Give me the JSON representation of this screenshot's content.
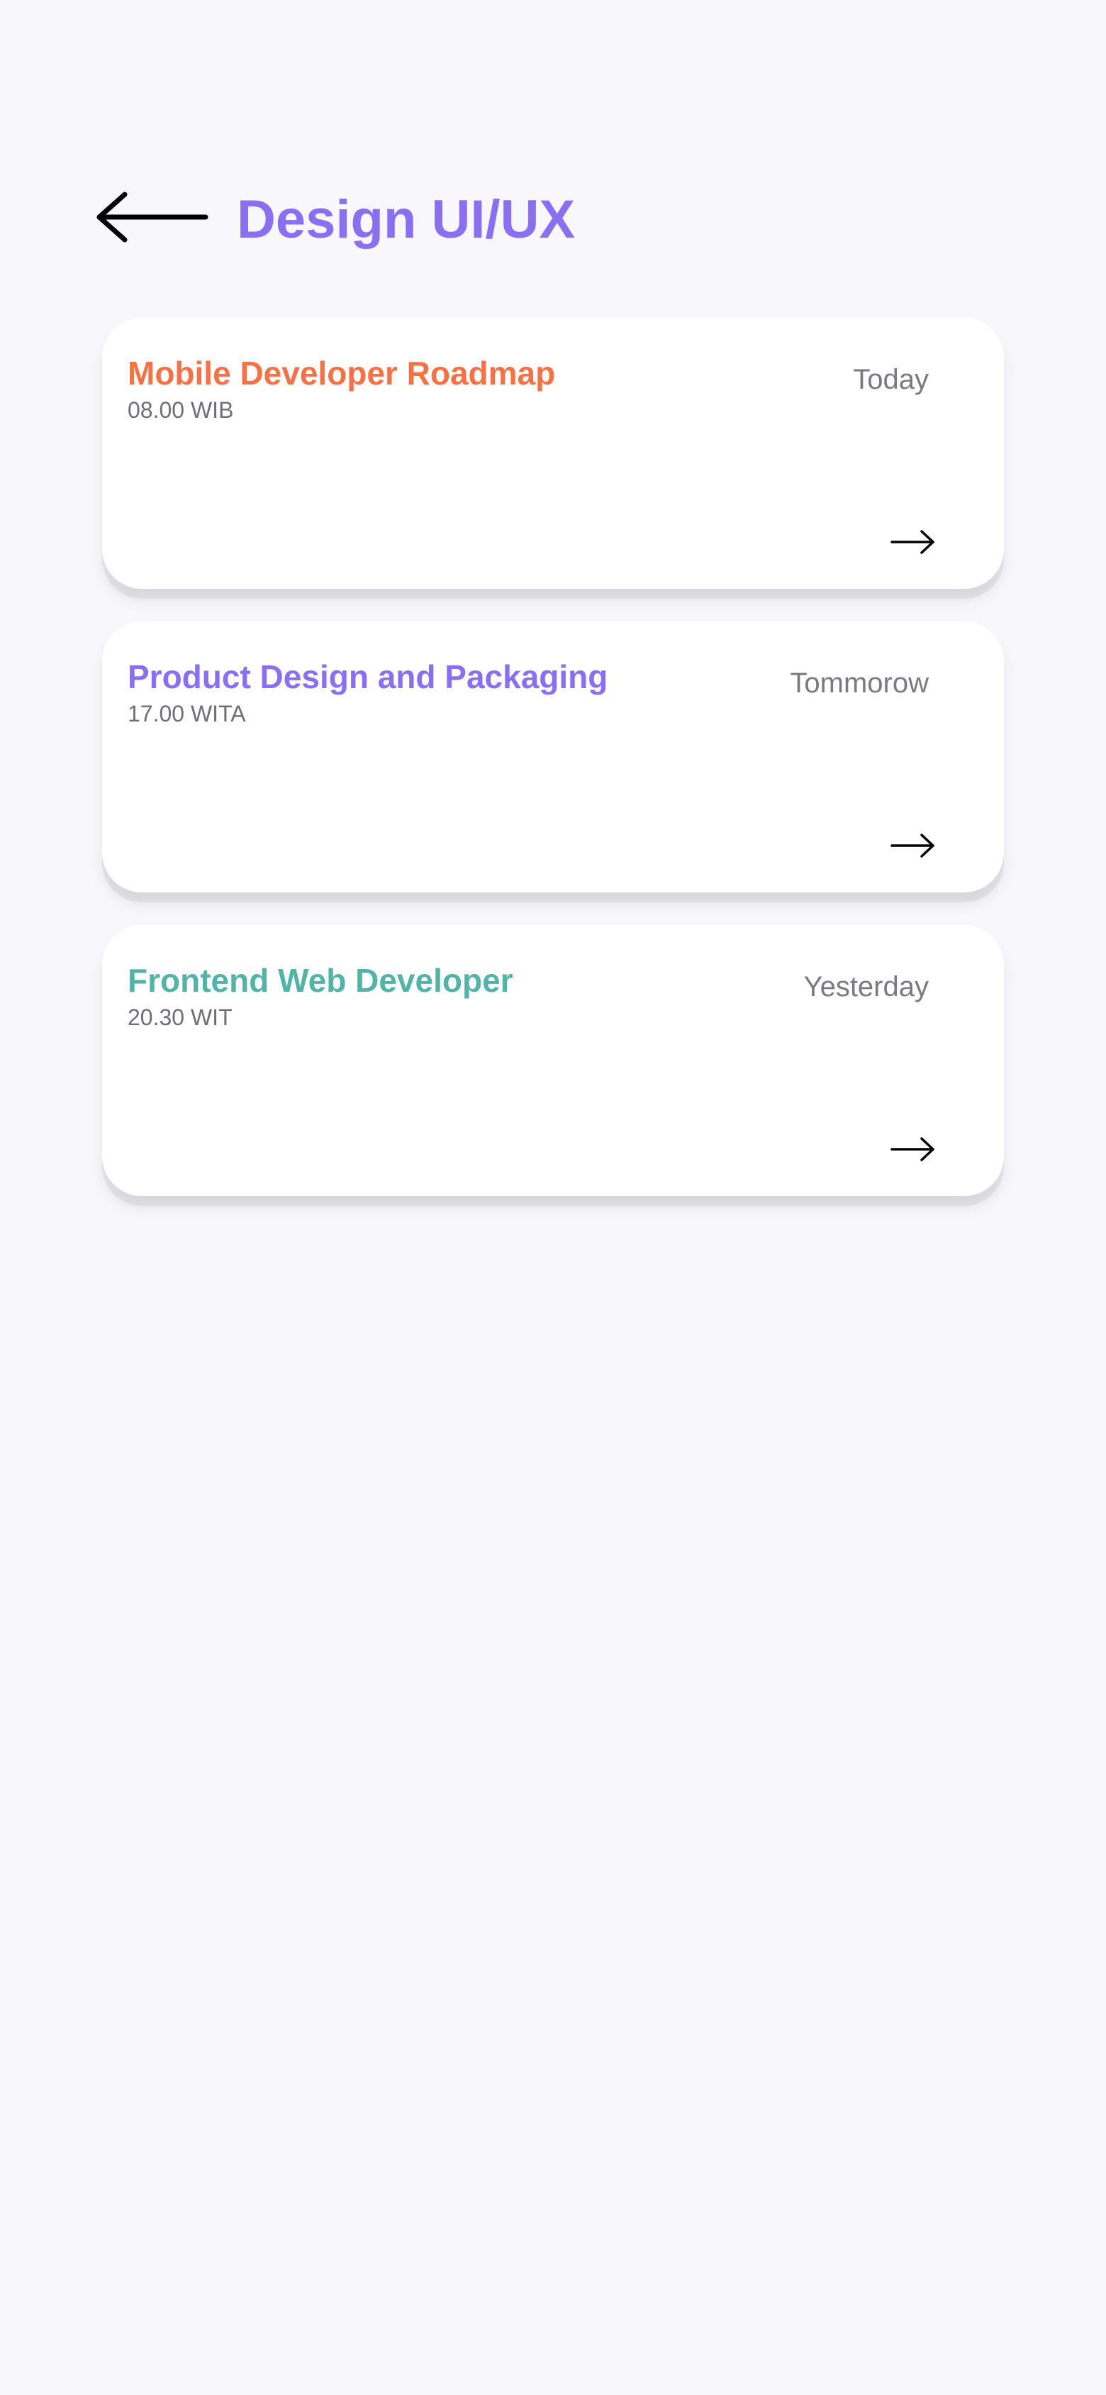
{
  "header": {
    "title": "Design UI/UX",
    "back_icon": "arrow-left-icon",
    "title_color": "#8A6FF0"
  },
  "courses": [
    {
      "title": "Mobile Developer Roadmap",
      "time": "08.00 WIB",
      "day": "Today",
      "color": "#F47245",
      "arrow_icon": "arrow-right-icon"
    },
    {
      "title": "Product Design and Packaging",
      "time": "17.00 WITA",
      "day": "Tommorow",
      "color": "#8A6FF0",
      "arrow_icon": "arrow-right-icon"
    },
    {
      "title": "Frontend Web Developer",
      "time": "20.30 WIT",
      "day": "Yesterday",
      "color": "#53B3A8",
      "arrow_icon": "arrow-right-icon"
    }
  ],
  "colors": {
    "background": "#F8F7FC",
    "card": "#FFFFFF",
    "muted_text": "#7A7A82"
  }
}
